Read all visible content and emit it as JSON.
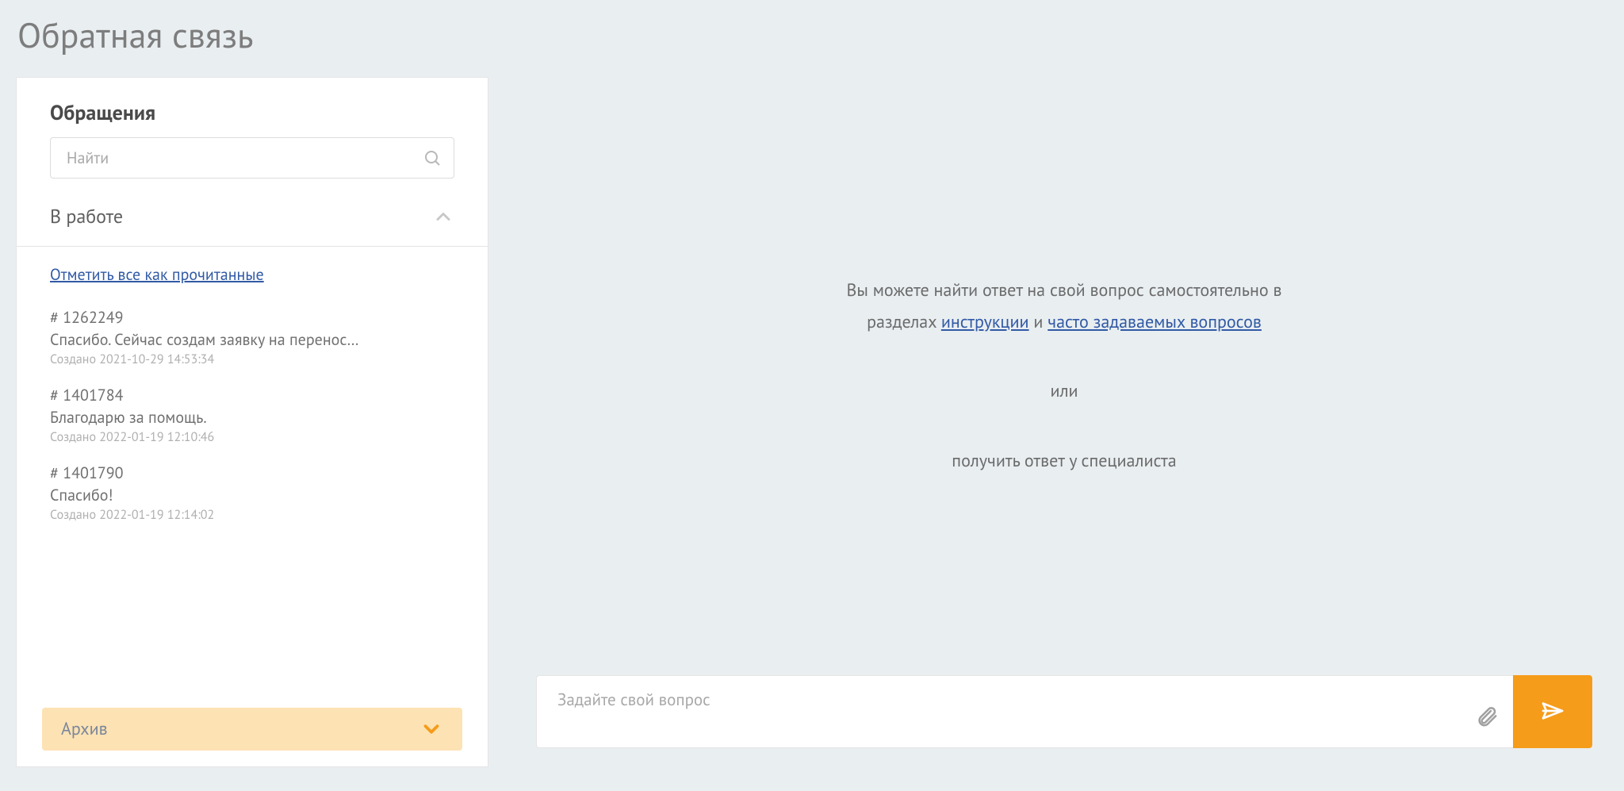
{
  "page": {
    "title": "Обратная связь"
  },
  "sidebar": {
    "heading": "Обращения",
    "search_placeholder": "Найти",
    "in_progress_label": "В работе",
    "mark_all_read": "Отметить все как прочитанные",
    "archive_label": "Архив",
    "tickets": [
      {
        "id": "# 1262249",
        "subject": "Спасибо. Сейчас создам заявку на перенос…",
        "created": "Создано 2021-10-29 14:53:34"
      },
      {
        "id": "# 1401784",
        "subject": "Благодарю за помощь.",
        "created": "Создано 2022-01-19 12:10:46"
      },
      {
        "id": "# 1401790",
        "subject": "Спасибо!",
        "created": "Создано 2022-01-19 12:14:02"
      }
    ]
  },
  "main": {
    "line1": "Вы можете найти ответ на свой вопрос самостоятельно в",
    "line2_prefix": "разделах ",
    "link_instructions": "инструкции",
    "line2_mid": "  и ",
    "link_faq": "часто задаваемых вопросов",
    "or": "или",
    "line3": "получить ответ у специалиста",
    "composer_placeholder": "Задайте свой вопрос"
  },
  "colors": {
    "accent": "#f59c1a",
    "link": "#315aa5"
  }
}
